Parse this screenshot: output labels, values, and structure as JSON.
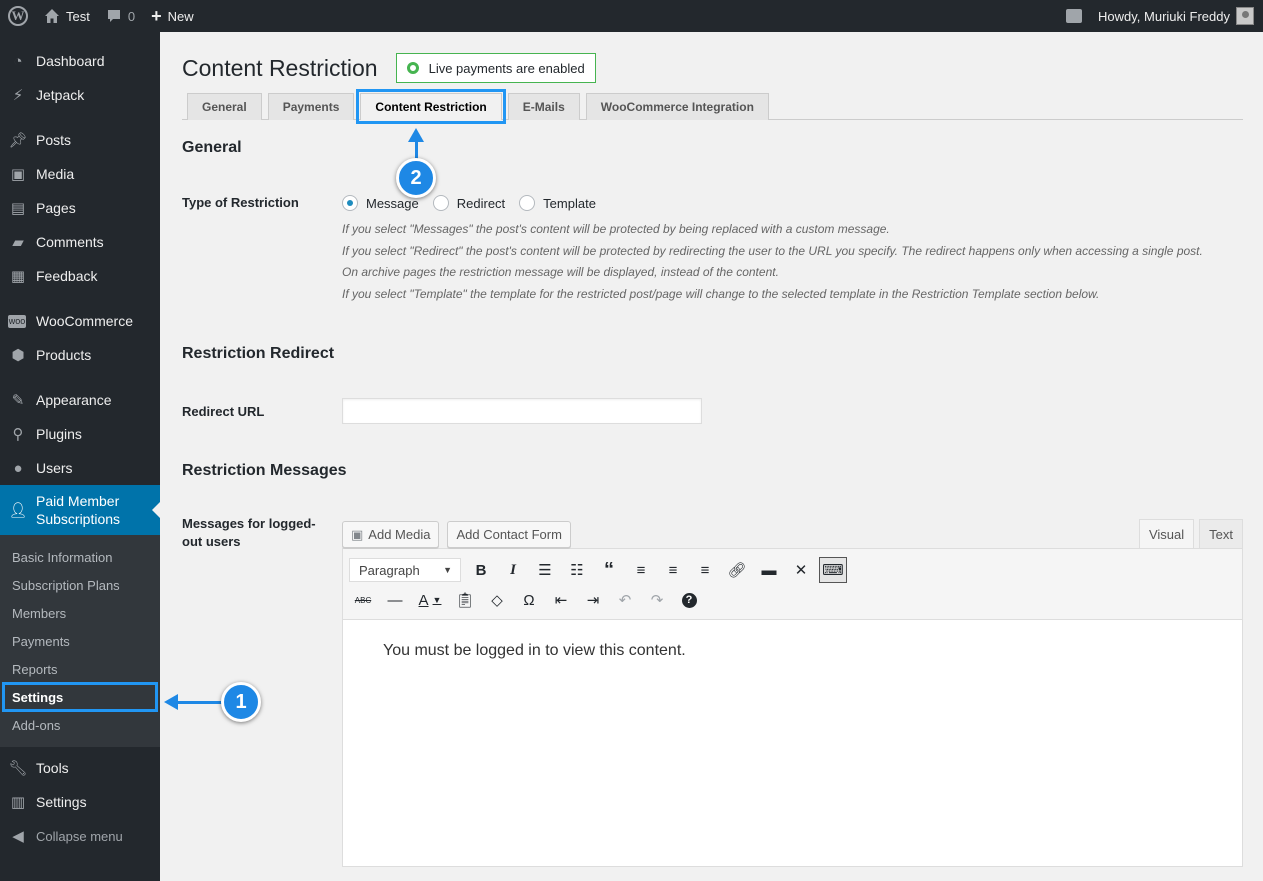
{
  "adminbar": {
    "site_name": "Test",
    "comments_count": "0",
    "new_label": "New",
    "greeting": "Howdy, Muriuki Freddy"
  },
  "sidebar": {
    "items": [
      {
        "label": "Dashboard",
        "icon": "dashboard-icon"
      },
      {
        "label": "Jetpack",
        "icon": "jetpack-icon"
      },
      {
        "label": "Posts",
        "icon": "pin-icon"
      },
      {
        "label": "Media",
        "icon": "media-icon"
      },
      {
        "label": "Pages",
        "icon": "pages-icon"
      },
      {
        "label": "Comments",
        "icon": "comment-icon"
      },
      {
        "label": "Feedback",
        "icon": "feedback-icon"
      },
      {
        "label": "WooCommerce",
        "icon": "woo-icon"
      },
      {
        "label": "Products",
        "icon": "box-icon"
      },
      {
        "label": "Appearance",
        "icon": "brush-icon"
      },
      {
        "label": "Plugins",
        "icon": "plug-icon"
      },
      {
        "label": "Users",
        "icon": "user-icon"
      },
      {
        "label": "Paid Member Subscriptions",
        "icon": "member-icon"
      },
      {
        "label": "Tools",
        "icon": "wrench-icon"
      },
      {
        "label": "Settings",
        "icon": "settings-icon"
      },
      {
        "label": "Collapse menu",
        "icon": "collapse-icon"
      }
    ],
    "submenu": [
      "Basic Information",
      "Subscription Plans",
      "Members",
      "Payments",
      "Reports",
      "Settings",
      "Add-ons"
    ]
  },
  "page": {
    "title": "Content Restriction",
    "live_badge": "Live payments are enabled",
    "tabs": [
      "General",
      "Payments",
      "Content Restriction",
      "E-Mails",
      "WooCommerce Integration"
    ]
  },
  "general": {
    "heading": "General",
    "type_label": "Type of Restriction",
    "options": [
      "Message",
      "Redirect",
      "Template"
    ],
    "selected": "Message",
    "desc1": "If you select \"Messages\" the post's content will be protected by being replaced with a custom message.",
    "desc2": "If you select \"Redirect\" the post's content will be protected by redirecting the user to the URL you specify. The redirect happens only when accessing a single post.",
    "desc3": "On archive pages the restriction message will be displayed, instead of the content.",
    "desc4": "If you select \"Template\" the template for the restricted post/page will change to the selected template in the Restriction Template section below."
  },
  "redirect": {
    "heading": "Restriction Redirect",
    "url_label": "Redirect URL",
    "url_value": ""
  },
  "messages": {
    "heading": "Restriction Messages",
    "logged_out_label": "Messages for logged-out users",
    "add_media": "Add Media",
    "add_contact_form": "Add Contact Form",
    "tab_visual": "Visual",
    "tab_text": "Text",
    "format_select": "Paragraph",
    "content": "You must be logged in to view this content."
  },
  "callouts": {
    "one": "1",
    "two": "2"
  },
  "colors": {
    "accent": "#0073aa",
    "callout": "#1e88e5",
    "live": "#46b450"
  }
}
